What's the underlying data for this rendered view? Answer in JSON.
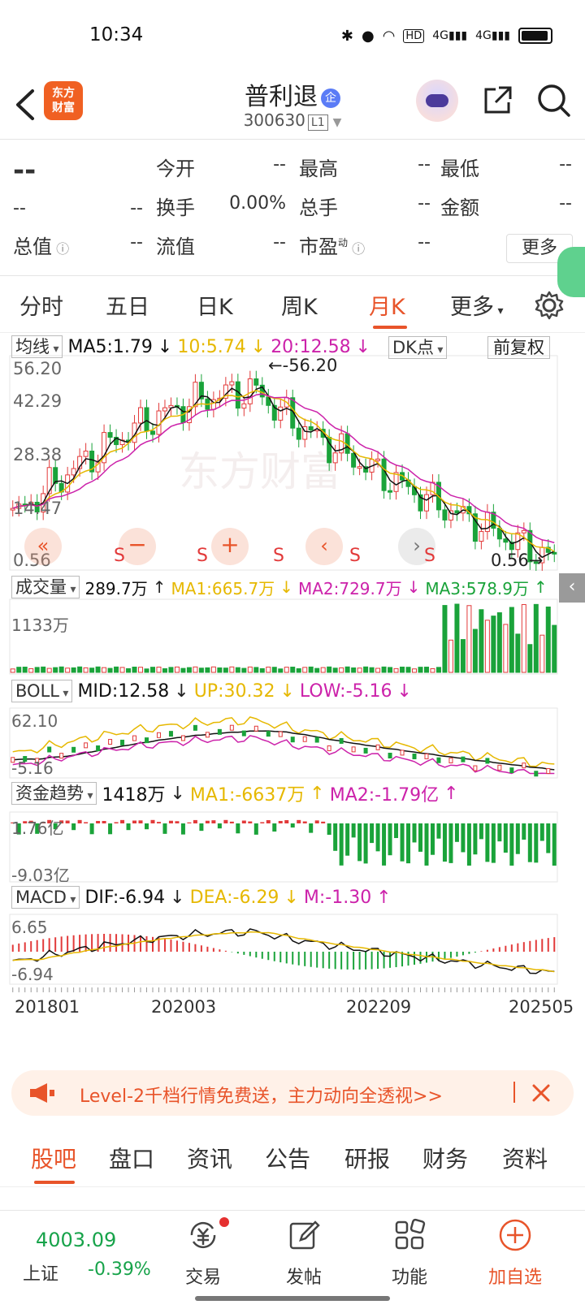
{
  "status_bar": {
    "time": "10:34",
    "hd": "HD",
    "net1": "4G",
    "net2": "4G"
  },
  "header": {
    "logo_line1": "东方",
    "logo_line2": "财富",
    "name": "普利退",
    "badge": "企",
    "code": "300630",
    "code_tag": "L1"
  },
  "quote": {
    "price": "--",
    "change1": "--",
    "change2": "--",
    "rows": [
      [
        {
          "label": "今开",
          "value": "--"
        },
        {
          "label": "最高",
          "value": "--"
        },
        {
          "label": "最低",
          "value": "--"
        }
      ],
      [
        {
          "label": "换手",
          "value": "0.00%"
        },
        {
          "label": "总手",
          "value": "--"
        },
        {
          "label": "金额",
          "value": "--"
        }
      ],
      [
        {
          "label": "总值",
          "value": "--"
        },
        {
          "label": "流值",
          "value": "--"
        },
        {
          "label": "市盈",
          "value": "--"
        }
      ]
    ],
    "pe_sup": "动",
    "more": "更多"
  },
  "period_tabs": [
    "分时",
    "五日",
    "日K",
    "周K",
    "月K",
    "更多"
  ],
  "active_period": "月K",
  "chart": {
    "ma_label": "均线",
    "ma5": "MA5:1.79",
    "ma10": "10:5.74",
    "ma20": "20:12.58",
    "dk_label": "DK点",
    "adjust_label": "前复权",
    "price_axis": [
      "56.20",
      "42.29",
      "28.38",
      "14.47",
      "0.56"
    ],
    "high_marker": "56.20",
    "low_marker": "0.56",
    "signal": "S",
    "volume": {
      "label": "成交量",
      "value": "289.7万",
      "ma1": "MA1:665.7万",
      "ma2": "MA2:729.7万",
      "ma3": "MA3:578.9万",
      "axis_top": "1133万"
    },
    "boll": {
      "label": "BOLL",
      "mid": "MID:12.58",
      "up": "UP:30.32",
      "low": "LOW:-5.16",
      "axis_top": "62.10",
      "axis_bottom": "-5.16"
    },
    "fund": {
      "label": "资金趋势",
      "value": "1418万",
      "ma1": "MA1:-6637万",
      "ma2": "MA2:-1.79亿",
      "axis_top": "1.76亿",
      "axis_bottom": "-9.03亿"
    },
    "macd": {
      "label": "MACD",
      "dif": "DIF:-6.94",
      "dea": "DEA:-6.29",
      "m": "M:-1.30",
      "axis_top": "6.65",
      "axis_bottom": "-6.94"
    },
    "dates": [
      "201801",
      "202003",
      "202209",
      "202505"
    ],
    "watermark": "东方财富",
    "colors": {
      "up": "#e23a3a",
      "down": "#1aa33a",
      "ma5": "#111111",
      "ma10": "#e6b800",
      "ma20": "#cc22aa",
      "accent": "#e8542a"
    }
  },
  "banner": {
    "text": "Level-2千档行情免费送，主力动向全透视>>"
  },
  "bottom_tabs": [
    "股吧",
    "盘口",
    "资讯",
    "公告",
    "研报",
    "财务",
    "资料"
  ],
  "active_bottom_tab": "股吧",
  "navbar": {
    "index_value": "4003.09",
    "index_name": "上证",
    "index_change": "-0.39%",
    "items": [
      {
        "label": "交易",
        "icon": "yuan-exchange-icon"
      },
      {
        "label": "发帖",
        "icon": "edit-icon"
      },
      {
        "label": "功能",
        "icon": "grid-icon"
      },
      {
        "label": "加自选",
        "icon": "add-circle-icon"
      }
    ]
  }
}
